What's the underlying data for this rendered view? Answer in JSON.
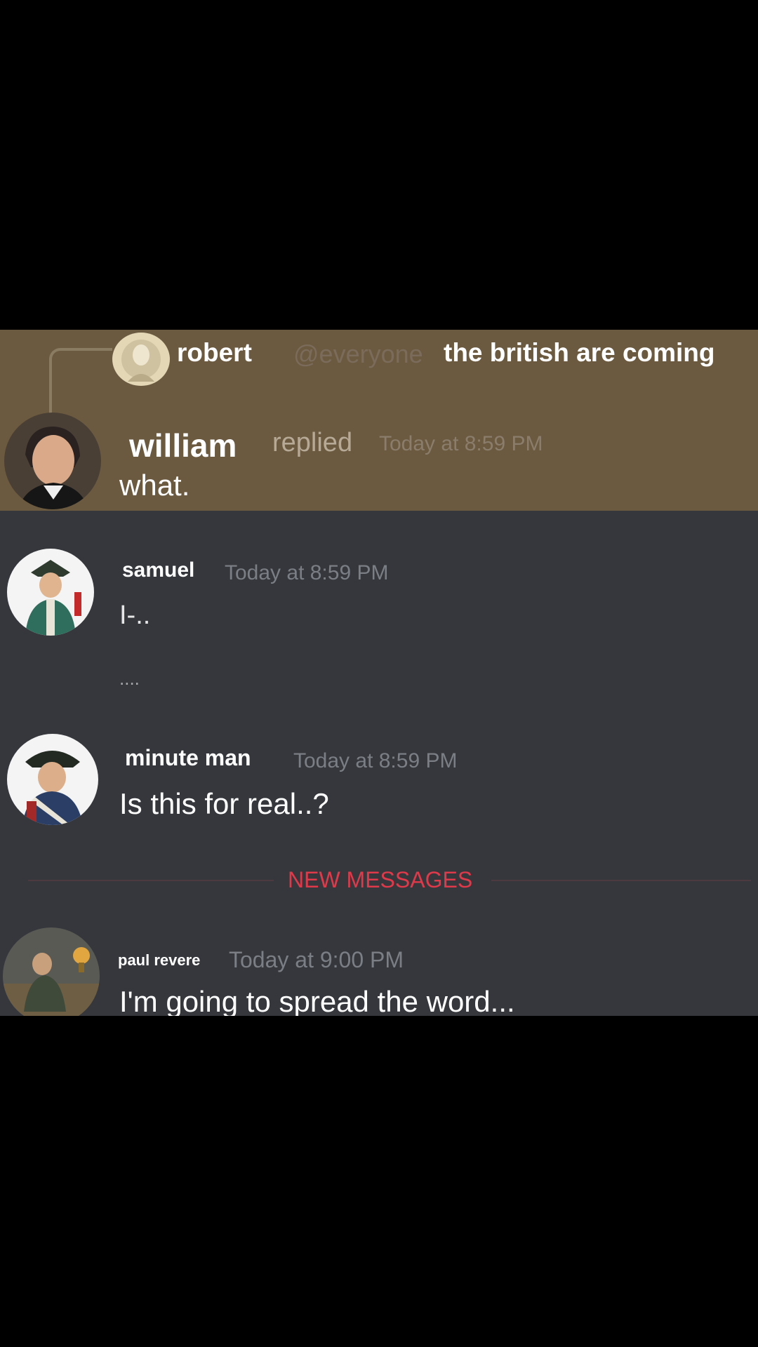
{
  "reply_preview": {
    "author": "robert",
    "mention": "@everyone",
    "text": "the british are coming"
  },
  "messages": [
    {
      "author": "william",
      "reply_tag": "replied",
      "time": "Today at 8:59 PM",
      "lines": [
        "what."
      ]
    },
    {
      "author": "samuel",
      "time": "Today at 8:59 PM",
      "lines": [
        "I-..",
        "...."
      ]
    },
    {
      "author": "minute man",
      "time": "Today at 8:59 PM",
      "lines": [
        "Is this for real..?"
      ]
    },
    {
      "author": "paul revere",
      "time": "Today at 9:00 PM",
      "lines": [
        "I'm going to spread the word..."
      ]
    }
  ],
  "divider": {
    "label": "NEW MESSAGES"
  },
  "colors": {
    "background": "#35373c",
    "highlight": "#6b5a40",
    "new_messages": "#e0394a",
    "mention": "#7a6b5a"
  }
}
